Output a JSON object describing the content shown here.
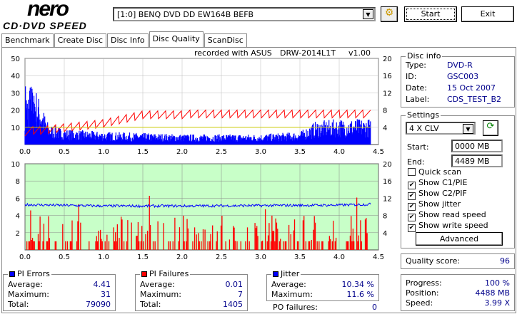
{
  "app": {
    "logo_top": "nero",
    "logo_bottom": "CD·DVD SPEED"
  },
  "toolbar": {
    "drive": "[1:0]  BENQ DVD DD EW164B BEFB",
    "start": "Start",
    "exit": "Exit"
  },
  "tabs": [
    "Benchmark",
    "Create Disc",
    "Disc Info",
    "Disc Quality",
    "ScanDisc"
  ],
  "recorded": {
    "text": "recorded with ASUS",
    "drive": "DRW-2014L1T",
    "ver": "v1.00"
  },
  "disc_info": {
    "title": "Disc info",
    "rows": [
      {
        "k": "Type:",
        "v": "DVD-R"
      },
      {
        "k": "ID:",
        "v": "GSC003"
      },
      {
        "k": "Date:",
        "v": "15 Oct 2007"
      },
      {
        "k": "Label:",
        "v": "CDS_TEST_B2"
      }
    ]
  },
  "settings": {
    "title": "Settings",
    "speed": "4 X CLV",
    "start_label": "Start:",
    "start": "0000 MB",
    "end_label": "End:",
    "end": "4489 MB",
    "checks": [
      {
        "l": "Quick scan",
        "c": false
      },
      {
        "l": "Show C1/PIE",
        "c": true
      },
      {
        "l": "Show C2/PIF",
        "c": true
      },
      {
        "l": "Show jitter",
        "c": true
      },
      {
        "l": "Show read speed",
        "c": true
      },
      {
        "l": "Show write speed",
        "c": true
      }
    ],
    "advanced": "Advanced"
  },
  "quality": {
    "label": "Quality score:",
    "value": "96"
  },
  "pi_errors": {
    "title": "PI Errors",
    "color": "#0000ff",
    "avg_l": "Average:",
    "avg": "4.41",
    "max_l": "Maximum:",
    "max": "31",
    "tot_l": "Total:",
    "tot": "79090"
  },
  "pi_failures": {
    "title": "PI Failures",
    "color": "#ff0000",
    "avg_l": "Average:",
    "avg": "0.01",
    "max_l": "Maximum:",
    "max": "7",
    "tot_l": "Total:",
    "tot": "1405"
  },
  "jitter": {
    "title": "Jitter",
    "color": "#0000ff",
    "avg_l": "Average:",
    "avg": "10.34 %",
    "max_l": "Maximum:",
    "max": "11.6 %",
    "po_l": "PO failures:",
    "po": "0"
  },
  "progress": {
    "p_l": "Progress:",
    "p": "100 %",
    "pos_l": "Position:",
    "pos": "4488 MB",
    "sp_l": "Speed:",
    "sp": "3.99 X"
  },
  "chart_data": [
    {
      "type": "bar",
      "title": "PI Errors / read speed",
      "x_ticks": [
        "0.0",
        "0.5",
        "1.0",
        "1.5",
        "2.0",
        "2.5",
        "3.0",
        "3.5",
        "4.0",
        "4.5"
      ],
      "xlim": [
        0,
        4.5
      ],
      "y_ticks": [
        "50",
        "40",
        "30",
        "20",
        "10"
      ],
      "ylim": [
        0,
        50
      ],
      "y2_ticks": [
        "20",
        "16",
        "12",
        "8",
        "4"
      ],
      "y2lim": [
        0,
        20
      ],
      "series": [
        {
          "name": "PI Errors",
          "color": "#0000ff",
          "x": [
            0,
            0.1,
            0.3,
            0.5,
            1,
            2,
            3,
            3.5,
            3.7,
            4,
            4.4
          ],
          "values": [
            20,
            25,
            8,
            6,
            5,
            4,
            4,
            5,
            9,
            10,
            10
          ]
        },
        {
          "name": "Read speed",
          "color": "#ff0000",
          "x": [
            0,
            0.5,
            1,
            1.5,
            4.4
          ],
          "values": [
            4,
            5,
            6,
            8,
            8
          ]
        },
        {
          "name": "Write speed",
          "color": "#ffff00",
          "x": [
            0,
            4.4
          ],
          "values": [
            4,
            4
          ]
        }
      ]
    },
    {
      "type": "bar",
      "title": "PI Failures / jitter",
      "x_ticks": [
        "0.0",
        "0.5",
        "1.0",
        "1.5",
        "2.0",
        "2.5",
        "3.0",
        "3.5",
        "4.0",
        "4.5"
      ],
      "xlim": [
        0,
        4.5
      ],
      "y_ticks": [
        "10",
        "8",
        "6",
        "4",
        "2"
      ],
      "ylim": [
        0,
        10
      ],
      "y2_ticks": [
        "20",
        "16",
        "12",
        "8",
        "4"
      ],
      "y2lim": [
        0,
        20
      ],
      "series": [
        {
          "name": "PI Failures",
          "color": "#ff0000",
          "max": 7
        },
        {
          "name": "Jitter",
          "color": "#0000ff",
          "x": [
            0,
            1,
            2,
            3,
            4,
            4.4
          ],
          "values": [
            10.5,
            10.2,
            10.2,
            10.3,
            10.4,
            10.6
          ]
        }
      ]
    }
  ]
}
